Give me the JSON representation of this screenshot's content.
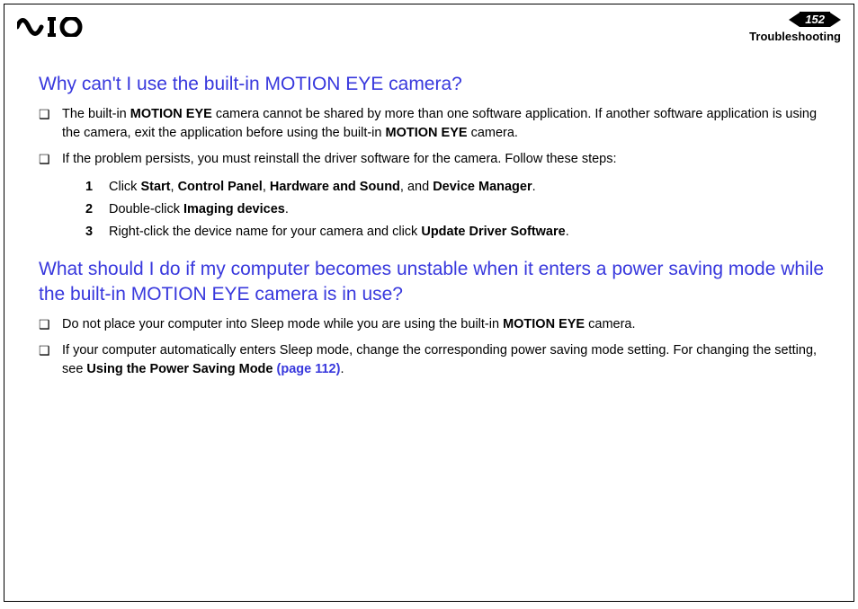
{
  "header": {
    "page_number": "152",
    "section": "Troubleshooting"
  },
  "q1": {
    "heading": "Why can't I use the built-in MOTION EYE camera?",
    "b1_pre": "The built-in ",
    "b1_bold1": "MOTION EYE",
    "b1_mid": " camera cannot be shared by more than one software application. If another software application is using the camera, exit the application before using the built-in ",
    "b1_bold2": "MOTION EYE",
    "b1_post": " camera.",
    "b2": "If the problem persists, you must reinstall the driver software for the camera. Follow these steps:",
    "s1_pre": "Click ",
    "s1_b1": "Start",
    "s1_c1": ", ",
    "s1_b2": "Control Panel",
    "s1_c2": ", ",
    "s1_b3": "Hardware and Sound",
    "s1_c3": ", and ",
    "s1_b4": "Device Manager",
    "s1_post": ".",
    "s2_pre": "Double-click ",
    "s2_b1": "Imaging devices",
    "s2_post": ".",
    "s3_pre": "Right-click the device name for your camera and click ",
    "s3_b1": "Update Driver Software",
    "s3_post": "."
  },
  "q2": {
    "heading": "What should I do if my computer becomes unstable when it enters a power saving mode while the built-in MOTION EYE camera is in use?",
    "b1_pre": "Do not place your computer into Sleep mode while you are using the built-in ",
    "b1_bold1": "MOTION EYE",
    "b1_post": " camera.",
    "b2_pre": "If your computer automatically enters Sleep mode, change the corresponding power saving mode setting. For changing the setting, see ",
    "b2_bold1": "Using the Power Saving Mode ",
    "b2_link": "(page 112)",
    "b2_post": "."
  },
  "nums": {
    "n1": "1",
    "n2": "2",
    "n3": "3"
  }
}
